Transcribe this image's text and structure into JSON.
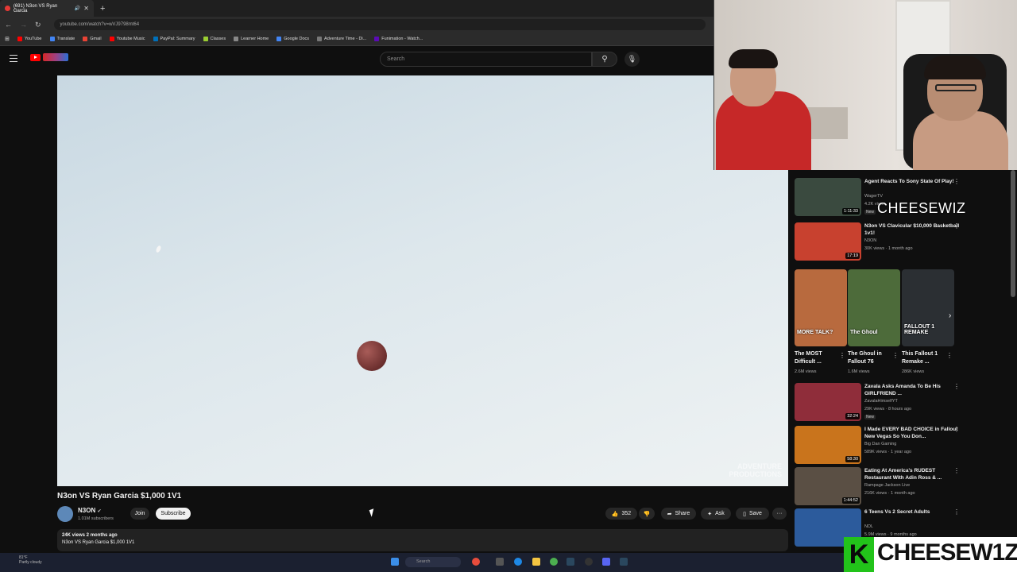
{
  "browser": {
    "tab_title": "(691) N3on VS Ryan Garcia",
    "tab_close": "✕",
    "new_tab": "+",
    "url": "youtube.com/watch?v=wVJ9798mt64",
    "bookmarks": [
      {
        "label": "YouTube",
        "color": "#ff0000"
      },
      {
        "label": "Translate",
        "color": "#4285f4"
      },
      {
        "label": "Gmail",
        "color": "#ea4335"
      },
      {
        "label": "Youtube Music",
        "color": "#ff0000"
      },
      {
        "label": "PayPal: Summary",
        "color": "#0070ba"
      },
      {
        "label": "Classes",
        "color": "#9acd32"
      },
      {
        "label": "Learner Home",
        "color": "#888888"
      },
      {
        "label": "Google Docs",
        "color": "#4285f4"
      },
      {
        "label": "Adventure Time - Di...",
        "color": "#777777"
      },
      {
        "label": "Funimation - Watch...",
        "color": "#5b0bb5"
      }
    ]
  },
  "youtube": {
    "search_placeholder": "Search",
    "video": {
      "title": "N3on VS Ryan Garcia $1,000 1V1",
      "watermark_line1": "ADVENTURE",
      "watermark_line2": "PRODUCTIONS",
      "channel": "N3ON",
      "subscribers": "1.01M subscribers",
      "join": "Join",
      "subscribe": "Subscribe",
      "likes": "352",
      "share": "Share",
      "ask": "Ask",
      "save": "Save",
      "more": "···",
      "views_date": "24K views  2 months ago",
      "description": "N3on VS Ryan Garcia $1,000 1V1"
    },
    "recommendations": [
      {
        "title": "Agent Reacts To Sony State Of Play!",
        "channel": "WagerTV",
        "meta": "4.2K views",
        "badge": "New",
        "duration": "1:11:33",
        "color": "#3a4a3f"
      },
      {
        "title": "N3on VS Clavicular $10,000 Basketball 1v1!",
        "channel": "N3ON",
        "meta": "30K views · 1 month ago",
        "badge": "",
        "duration": "17:19",
        "color": "#c8412f"
      },
      {
        "title": "Zavala Asks Amanda To Be His GIRLFRIEND ...",
        "channel": "ZavalaHimselfYT",
        "meta": "29K views · 8 hours ago",
        "badge": "New",
        "duration": "32:24",
        "color": "#8f2d3a"
      },
      {
        "title": "I Made EVERY BAD CHOICE in Fallout New Vegas So You Don...",
        "channel": "Big Dan Gaming",
        "meta": "589K views · 1 year ago",
        "badge": "",
        "duration": "58:30",
        "color": "#c9741c"
      },
      {
        "title": "Eating At America's RUDEST Restaurant With Adin Ross & ...",
        "channel": "Rampage Jackson Live",
        "meta": "216K views · 1 month ago",
        "badge": "",
        "duration": "1:44:52",
        "color": "#5a4f44"
      },
      {
        "title": "6 Teens Vs 2 Secret Adults",
        "channel": "NDL",
        "meta": "5.9M views · 9 months ago",
        "badge": "",
        "duration": "",
        "color": "#2c5b9c"
      }
    ],
    "shorts": [
      {
        "title": "The MOST Difficult ...",
        "views": "2.6M views",
        "thumb_text": "MORE TALK?",
        "color": "#b86a3e"
      },
      {
        "title": "The Ghoul in Fallout 76",
        "views": "1.6M views",
        "thumb_text": "The Ghoul",
        "color": "#4d6b3a"
      },
      {
        "title": "This Fallout 1 Remake ...",
        "views": "286K views",
        "thumb_text": "FALLOUT 1 REMAKE",
        "color": "#2b2f33"
      }
    ]
  },
  "stream_overlay": {
    "top_name": "CHEESEWIZ",
    "logo_letter": "K",
    "logo_text": "CHEESEW1Z"
  },
  "taskbar": {
    "search": "Search",
    "weather_line1": "81°F",
    "weather_line2": "Partly cloudy"
  }
}
